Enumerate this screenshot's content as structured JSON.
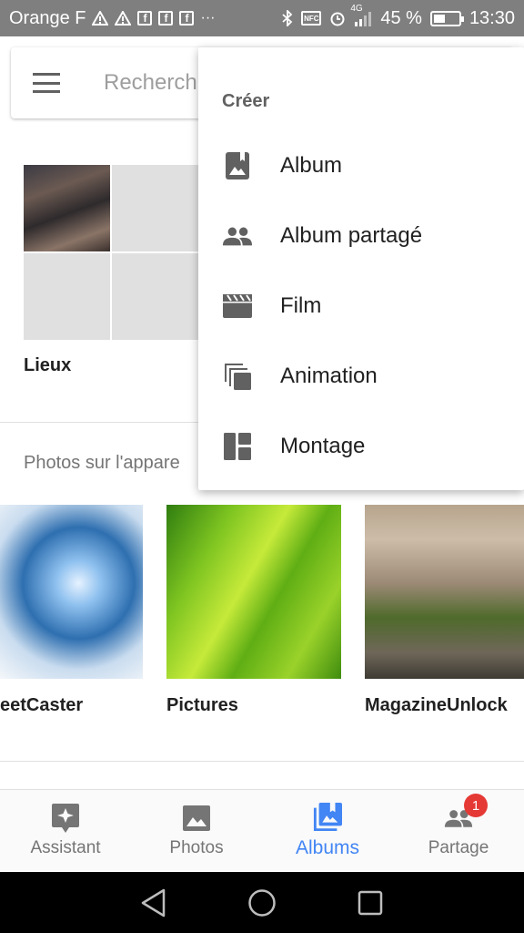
{
  "status_bar": {
    "carrier": "Orange F",
    "notification_icons": [
      "warning-icon",
      "warning-icon",
      "facebook-icon",
      "facebook-icon",
      "facebook-icon",
      "more-icon"
    ],
    "more_glyph": "···",
    "fb_glyph": "f",
    "nfc_label": "NFC",
    "network": "4G",
    "battery": "45 %",
    "time": "13:30"
  },
  "search": {
    "placeholder": "Recherch"
  },
  "albums": {
    "places_label": "Lieux"
  },
  "device_section": {
    "title": "Photos sur l'appare",
    "folders": [
      {
        "label": "eetCaster"
      },
      {
        "label": "Pictures"
      },
      {
        "label": "MagazineUnlock"
      }
    ]
  },
  "create_menu": {
    "header": "Créer",
    "items": [
      {
        "label": "Album",
        "icon": "album-icon"
      },
      {
        "label": "Album partagé",
        "icon": "people-icon"
      },
      {
        "label": "Film",
        "icon": "film-icon"
      },
      {
        "label": "Animation",
        "icon": "animation-icon"
      },
      {
        "label": "Montage",
        "icon": "collage-icon"
      }
    ]
  },
  "bottom_nav": {
    "items": [
      {
        "label": "Assistant",
        "icon": "assistant-icon"
      },
      {
        "label": "Photos",
        "icon": "photo-icon"
      },
      {
        "label": "Albums",
        "icon": "albums-icon",
        "active": true
      },
      {
        "label": "Partage",
        "icon": "sharing-icon",
        "badge": "1"
      }
    ],
    "active_color": "#4285f4",
    "badge_color": "#e53935"
  },
  "system_nav": {
    "buttons": [
      "back-icon",
      "home-icon",
      "recents-icon"
    ]
  }
}
